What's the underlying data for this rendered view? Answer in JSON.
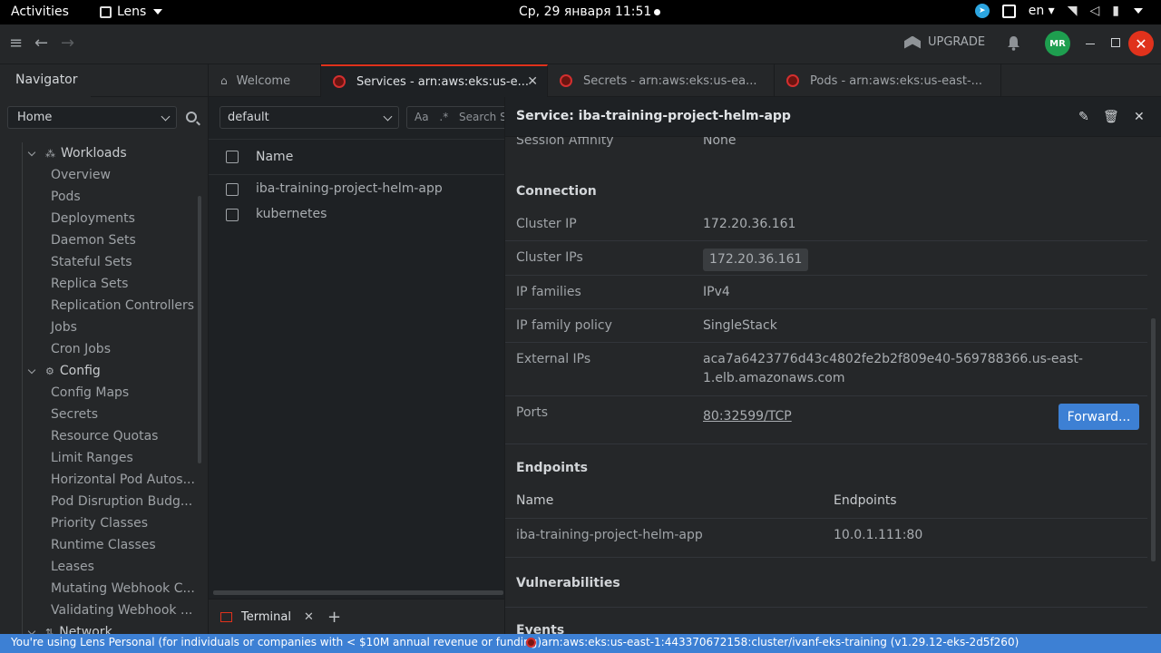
{
  "system_bar": {
    "activities": "Activities",
    "app_name": "Lens",
    "clock": "Ср, 29 января  11:51",
    "language": "en"
  },
  "header": {
    "upgrade_label": "UPGRADE",
    "avatar_initials": "MR"
  },
  "sidebar": {
    "title": "Navigator",
    "selector_value": "Home",
    "groups": {
      "workloads": "Workloads",
      "config": "Config",
      "network": "Network"
    },
    "workload_items": [
      "Overview",
      "Pods",
      "Deployments",
      "Daemon Sets",
      "Stateful Sets",
      "Replica Sets",
      "Replication Controllers",
      "Jobs",
      "Cron Jobs"
    ],
    "config_items": [
      "Config Maps",
      "Secrets",
      "Resource Quotas",
      "Limit Ranges",
      "Horizontal Pod Autos...",
      "Pod Disruption Budg...",
      "Priority Classes",
      "Runtime Classes",
      "Leases",
      "Mutating Webhook C...",
      "Validating Webhook ..."
    ]
  },
  "tabs": [
    {
      "label": "Welcome"
    },
    {
      "label": "Services - arn:aws:eks:us-e..."
    },
    {
      "label": "Secrets - arn:aws:eks:us-ea..."
    },
    {
      "label": "Pods - arn:aws:eks:us-east-..."
    }
  ],
  "list": {
    "namespace": "default",
    "search_placeholder": "Search S",
    "search_aa": "Aa",
    "search_regex": ".*",
    "column_name": "Name",
    "rows": [
      "iba-training-project-helm-app",
      "kubernetes"
    ]
  },
  "terminal": {
    "label": "Terminal"
  },
  "details": {
    "title": "Service: iba-training-project-helm-app",
    "session_affinity_label": "Session Affinity",
    "session_affinity_value": "None",
    "connection_title": "Connection",
    "cluster_ip_label": "Cluster IP",
    "cluster_ip_value": "172.20.36.161",
    "cluster_ips_label": "Cluster IPs",
    "cluster_ips_value": "172.20.36.161",
    "ip_families_label": "IP families",
    "ip_families_value": "IPv4",
    "ip_family_policy_label": "IP family policy",
    "ip_family_policy_value": "SingleStack",
    "external_ips_label": "External IPs",
    "external_ips_line1": "aca7a6423776d43c4802fe2b2f809e40-569788366.us-east-",
    "external_ips_line2": "1.elb.amazonaws.com",
    "ports_label": "Ports",
    "ports_value": "80:32599/TCP",
    "forward_label": "Forward...",
    "endpoints_title": "Endpoints",
    "endpoints_col_name": "Name",
    "endpoints_col_endpoints": "Endpoints",
    "endpoint_name": "iba-training-project-helm-app",
    "endpoint_value": "10.0.1.111:80",
    "vulnerabilities_title": "Vulnerabilities",
    "events_title": "Events"
  },
  "status_bar": {
    "message": "You're using Lens Personal (for individuals or companies with < $10M annual revenue or funding)",
    "cluster": "arn:aws:eks:us-east-1:443370672158:cluster/ivanf-eks-training (v1.29.12-eks-2d5f260)"
  },
  "colors": {
    "accent_blue": "#3d80d4",
    "close_red": "#e0321c",
    "avatar_green": "#1e9e4f"
  }
}
